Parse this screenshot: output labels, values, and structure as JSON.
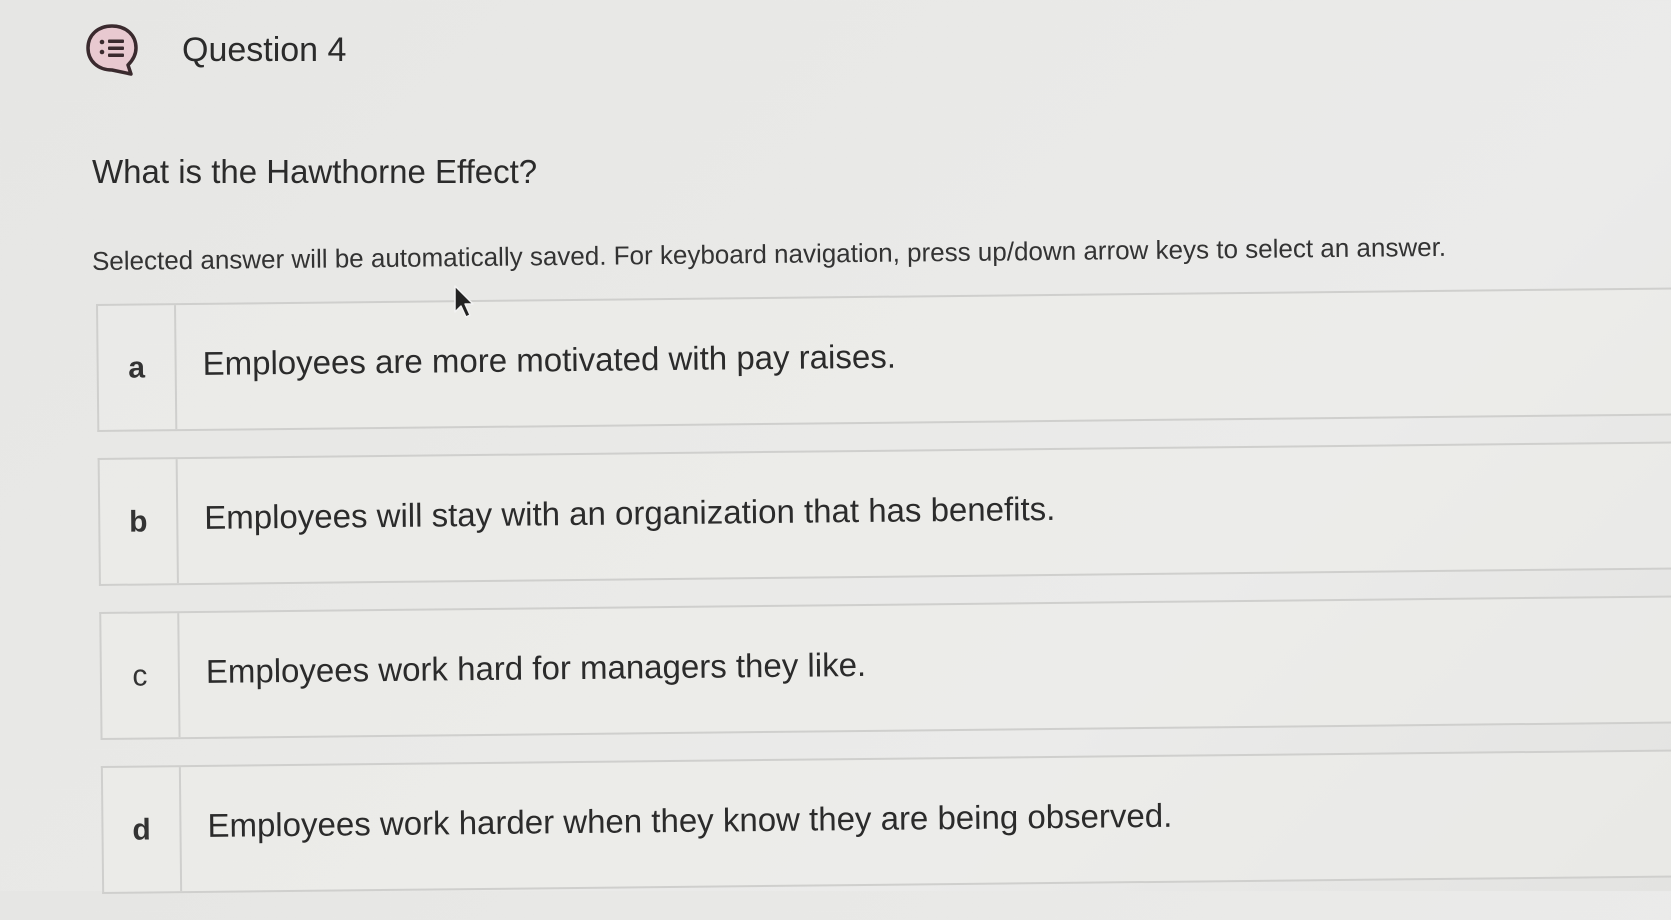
{
  "header": {
    "icon": "question-list-icon",
    "title": "Question 4"
  },
  "question": {
    "text": "What is the Hawthorne Effect?"
  },
  "instructions": "Selected answer will be automatically saved. For keyboard navigation, press up/down arrow keys to select an answer.",
  "options": [
    {
      "letter": "a",
      "text": "Employees are more motivated with pay raises."
    },
    {
      "letter": "b",
      "text": "Employees will stay with an organization that has benefits."
    },
    {
      "letter": "c",
      "text": "Employees work hard for managers they like."
    },
    {
      "letter": "d",
      "text": "Employees work harder when they know they are being observed."
    }
  ],
  "colors": {
    "icon_bg": "#e8c9d0",
    "icon_stroke": "#3a2a2e"
  }
}
